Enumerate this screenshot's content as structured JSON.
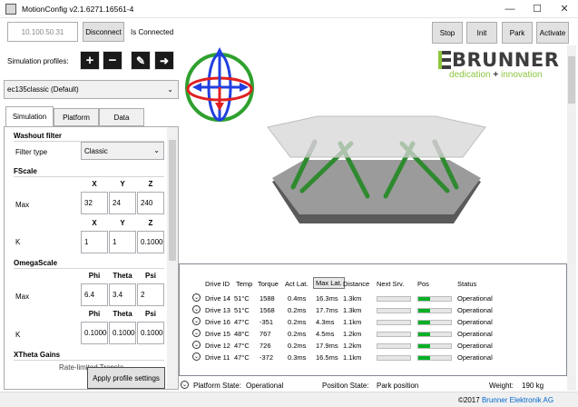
{
  "window": {
    "title": "MotionConfig v2.1.6271.16561-4",
    "minimize": "—",
    "maximize": "☐",
    "close": "✕"
  },
  "connection": {
    "ip_placeholder": "10.100.50.31",
    "disconnect_label": "Disconnect",
    "status": "Is Connected"
  },
  "actions": {
    "stop": "Stop",
    "init": "Init",
    "park": "Park",
    "activate": "Activate"
  },
  "profiles": {
    "label": "Simulation profiles:",
    "selected": "ec135classic (Default)",
    "icons": [
      "plus-icon",
      "minus-icon",
      "pencil-icon",
      "export-icon"
    ]
  },
  "brand": {
    "name": "BRUNNER",
    "tagline_left": "dedication",
    "tagline_sep": "+",
    "tagline_right": "innovation",
    "color": "#3d3d3d",
    "accent": "#8dc63f"
  },
  "tabs": [
    {
      "label": "Simulation",
      "active": true
    },
    {
      "label": "Platform",
      "active": false
    },
    {
      "label": "Data",
      "active": false
    }
  ],
  "washout": {
    "title": "Washout filter",
    "filter_label": "Filter type",
    "filter_value": "Classic"
  },
  "fscale": {
    "title": "FScale",
    "headers": [
      "X",
      "Y",
      "Z"
    ],
    "max_label": "Max",
    "max_values": [
      "32",
      "24",
      "240"
    ],
    "k_label": "K",
    "k_values": [
      "1",
      "1",
      "0.100000"
    ]
  },
  "omegascale": {
    "title": "OmegaScale",
    "headers": [
      "Phi",
      "Theta",
      "Psi"
    ],
    "max_label": "Max",
    "max_values": [
      "6.4",
      "3.4",
      "2"
    ],
    "k_label": "K",
    "k_values": [
      "0.100000",
      "0.100000",
      "0.100000"
    ]
  },
  "xtheta": {
    "title": "XTheta Gains",
    "partial": "Rate-limited  Transla.."
  },
  "apply_label": "Apply profile settings",
  "drives": {
    "headers": {
      "id": "Drive ID",
      "temp": "Temp",
      "torque": "Torque",
      "act": "Act Lat.",
      "max": "Max Lat.",
      "dist": "Distance",
      "next": "Next Srv.",
      "pos": "Pos",
      "status": "Status"
    },
    "rows": [
      {
        "id": "Drive 14",
        "temp": "51°C",
        "torque": "1588",
        "act": "0.4ms",
        "max": "16.3ms",
        "dist": "1.3km",
        "pos": 0.35,
        "status": "Operational"
      },
      {
        "id": "Drive 13",
        "temp": "51°C",
        "torque": "1568",
        "act": "0.2ms",
        "max": "17.7ms",
        "dist": "1.3km",
        "pos": 0.35,
        "status": "Operational"
      },
      {
        "id": "Drive 16",
        "temp": "47°C",
        "torque": "-351",
        "act": "0.2ms",
        "max": "4.3ms",
        "dist": "1.1km",
        "pos": 0.35,
        "status": "Operational"
      },
      {
        "id": "Drive 15",
        "temp": "48°C",
        "torque": "767",
        "act": "0.2ms",
        "max": "4.5ms",
        "dist": "1.2km",
        "pos": 0.35,
        "status": "Operational"
      },
      {
        "id": "Drive 12",
        "temp": "47°C",
        "torque": "726",
        "act": "0.2ms",
        "max": "17.9ms",
        "dist": "1.2km",
        "pos": 0.35,
        "status": "Operational"
      },
      {
        "id": "Drive 11",
        "temp": "47°C",
        "torque": "-372",
        "act": "0.3ms",
        "max": "16.5ms",
        "dist": "1.1km",
        "pos": 0.35,
        "status": "Operational"
      }
    ]
  },
  "status": {
    "platform_label": "Platform State:",
    "platform_value": "Operational",
    "position_label": "Position State:",
    "position_value": "Park position",
    "weight_label": "Weight:",
    "weight_value": "190 kg"
  },
  "footer": {
    "copyright": "©2017",
    "company": "Brunner Elektronik AG"
  }
}
